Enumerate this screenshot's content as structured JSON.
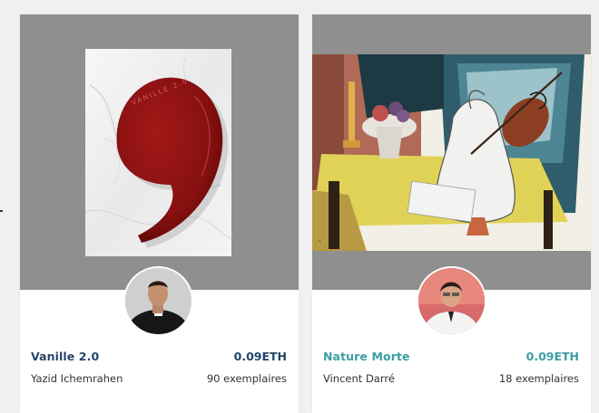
{
  "colors": {
    "page_background": "#f0f0f0",
    "media_background": "#8f8f8f",
    "card_title_dark": "#24456b",
    "card_title_teal": "#3b9ea3"
  },
  "cards": [
    {
      "title": "Vanille 2.0",
      "price": "0.09ETH",
      "artist": "Yazid Ichemrahen",
      "copies": "90 exemplaires",
      "artwork_text": "VANILLE 2.0",
      "artwork": "red-comma-sculpture-on-marble",
      "avatar": "artist-portrait"
    },
    {
      "title": "Nature Morte",
      "price": "0.09ETH",
      "artist": "Vincent Darré",
      "copies": "18 exemplaires",
      "artwork": "still-life-painting-violin-swan",
      "avatar": "artist-portrait"
    }
  ]
}
